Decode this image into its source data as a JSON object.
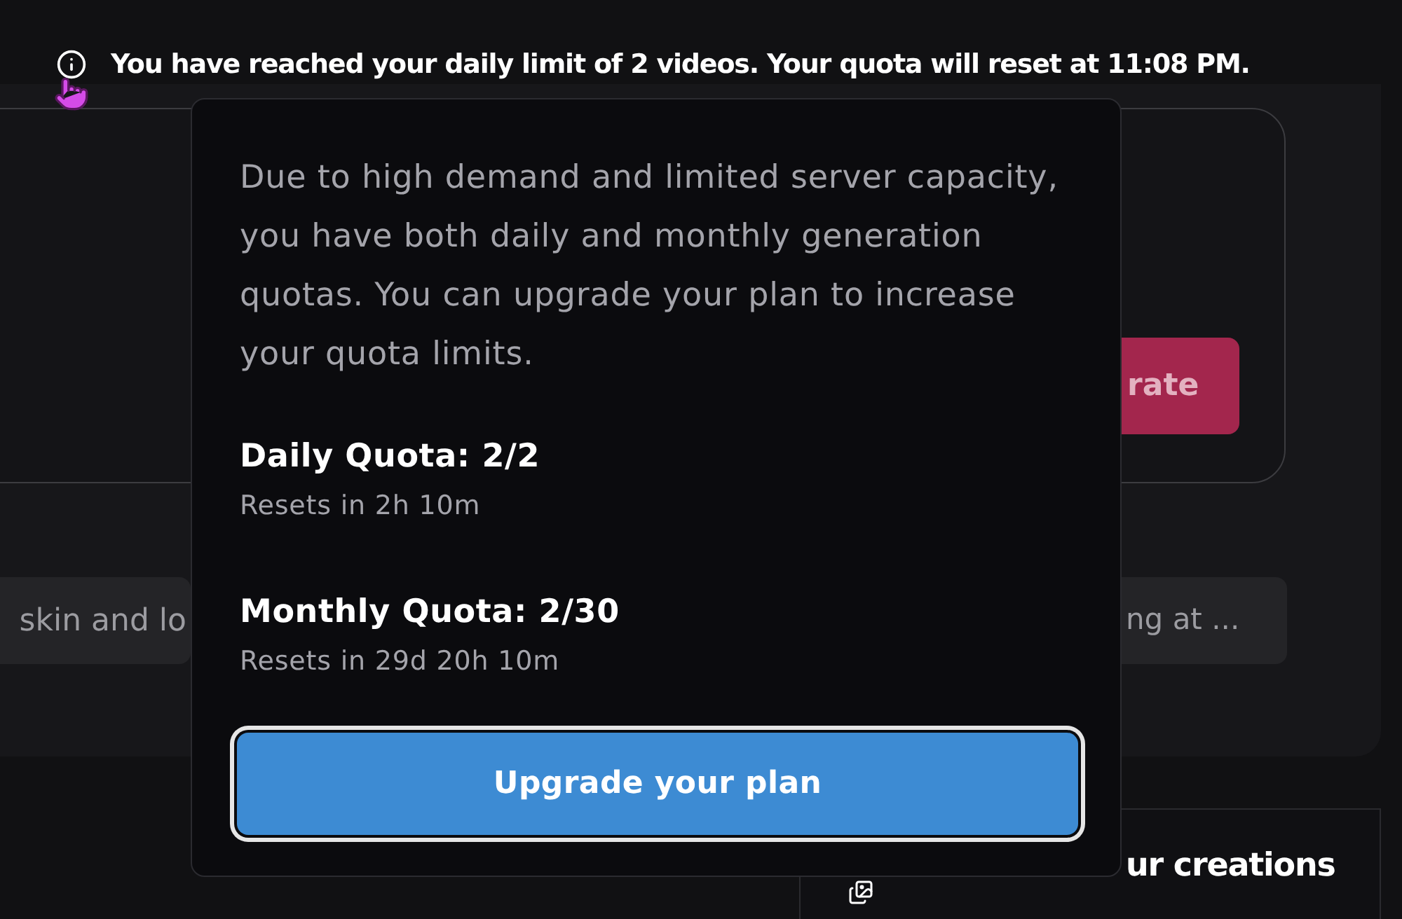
{
  "notice": {
    "text": "You have reached your daily limit of 2 videos. Your quota will reset at 11:08 PM."
  },
  "generate_card": {
    "button_label": "rate"
  },
  "suggestions": [
    {
      "text": "skin and lo"
    },
    {
      "text": "ng at ..."
    }
  ],
  "creations_panel": {
    "label": "ur creations"
  },
  "quota_popover": {
    "description": "Due to high demand and limited server capacity, you have both daily and monthly generation quotas. You can upgrade your plan to increase your quota limits.",
    "quotas": [
      {
        "title": "Daily Quota: 2/2",
        "reset": "Resets in 2h 10m"
      },
      {
        "title": "Monthly Quota: 2/30",
        "reset": "Resets in 29d 20h 10m"
      }
    ],
    "upgrade_button": {
      "label": "Upgrade your plan",
      "focused": true
    }
  }
}
